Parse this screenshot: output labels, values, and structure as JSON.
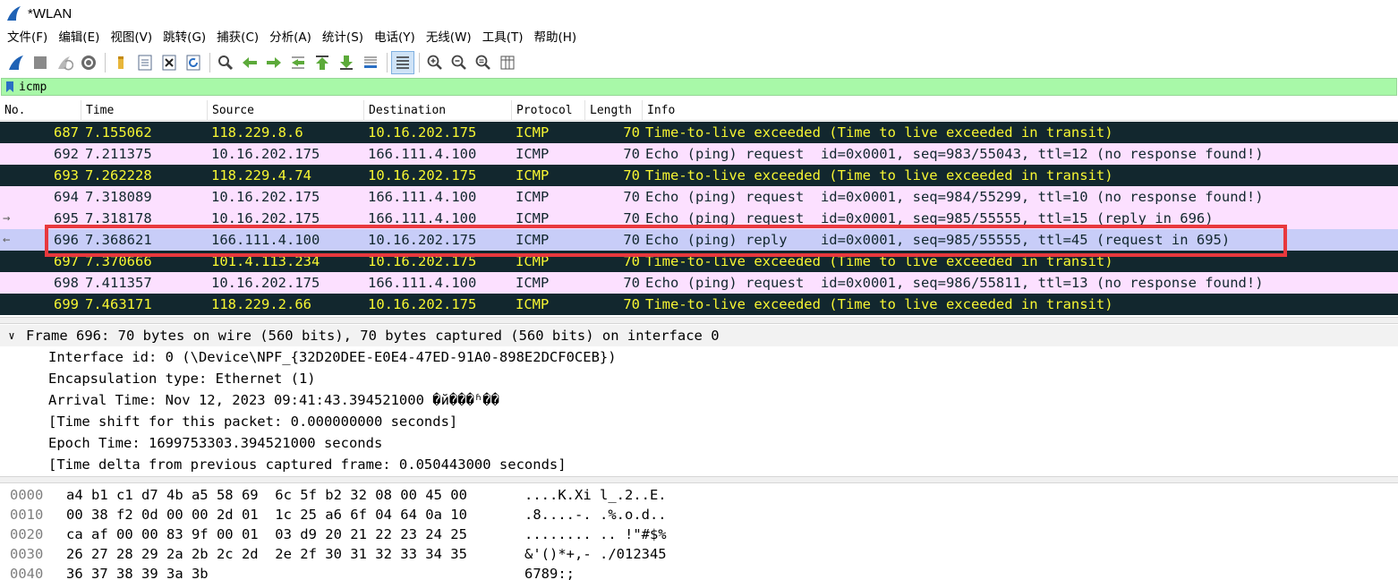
{
  "window": {
    "title": "*WLAN"
  },
  "menu": [
    "文件(F)",
    "编辑(E)",
    "视图(V)",
    "跳转(G)",
    "捕获(C)",
    "分析(A)",
    "统计(S)",
    "电话(Y)",
    "无线(W)",
    "工具(T)",
    "帮助(H)"
  ],
  "toolbar": {
    "icons": [
      "start-capture-icon",
      "stop-capture-icon",
      "restart-capture-icon",
      "capture-options-icon",
      "open-file-icon",
      "save-file-icon",
      "close-file-icon",
      "reload-file-icon",
      "find-packet-icon",
      "go-back-icon",
      "go-forward-icon",
      "go-to-packet-icon",
      "go-first-icon",
      "go-last-icon",
      "autoscroll-icon",
      "colorize-icon",
      "zoom-in-icon",
      "zoom-out-icon",
      "zoom-normal-icon",
      "resize-columns-icon"
    ]
  },
  "filter": {
    "value": "icmp"
  },
  "columns": [
    "No.",
    "Time",
    "Source",
    "Destination",
    "Protocol",
    "Length",
    "Info"
  ],
  "packets": [
    {
      "no": "687",
      "time": "7.155062",
      "src": "118.229.8.6",
      "dst": "10.16.202.175",
      "proto": "ICMP",
      "len": "70",
      "info": "Time-to-live exceeded (Time to live exceeded in transit)",
      "style": "ttl",
      "arrow": ""
    },
    {
      "no": "692",
      "time": "7.211375",
      "src": "10.16.202.175",
      "dst": "166.111.4.100",
      "proto": "ICMP",
      "len": "70",
      "info": "Echo (ping) request  id=0x0001, seq=983/55043, ttl=12 (no response found!)",
      "style": "echo",
      "arrow": ""
    },
    {
      "no": "693",
      "time": "7.262228",
      "src": "118.229.4.74",
      "dst": "10.16.202.175",
      "proto": "ICMP",
      "len": "70",
      "info": "Time-to-live exceeded (Time to live exceeded in transit)",
      "style": "ttl",
      "arrow": ""
    },
    {
      "no": "694",
      "time": "7.318089",
      "src": "10.16.202.175",
      "dst": "166.111.4.100",
      "proto": "ICMP",
      "len": "70",
      "info": "Echo (ping) request  id=0x0001, seq=984/55299, ttl=10 (no response found!)",
      "style": "echo",
      "arrow": ""
    },
    {
      "no": "695",
      "time": "7.318178",
      "src": "10.16.202.175",
      "dst": "166.111.4.100",
      "proto": "ICMP",
      "len": "70",
      "info": "Echo (ping) request  id=0x0001, seq=985/55555, ttl=15 (reply in 696)",
      "style": "echo",
      "arrow": "→"
    },
    {
      "no": "696",
      "time": "7.368621",
      "src": "166.111.4.100",
      "dst": "10.16.202.175",
      "proto": "ICMP",
      "len": "70",
      "info": "Echo (ping) reply    id=0x0001, seq=985/55555, ttl=45 (request in 695)",
      "style": "sel",
      "arrow": "←"
    },
    {
      "no": "697",
      "time": "7.370666",
      "src": "101.4.113.234",
      "dst": "10.16.202.175",
      "proto": "ICMP",
      "len": "70",
      "info": "Time-to-live exceeded (Time to live exceeded in transit)",
      "style": "ttl",
      "arrow": ""
    },
    {
      "no": "698",
      "time": "7.411357",
      "src": "10.16.202.175",
      "dst": "166.111.4.100",
      "proto": "ICMP",
      "len": "70",
      "info": "Echo (ping) request  id=0x0001, seq=986/55811, ttl=13 (no response found!)",
      "style": "echo",
      "arrow": ""
    },
    {
      "no": "699",
      "time": "7.463171",
      "src": "118.229.2.66",
      "dst": "10.16.202.175",
      "proto": "ICMP",
      "len": "70",
      "info": "Time-to-live exceeded (Time to live exceeded in transit)",
      "style": "ttl",
      "arrow": ""
    }
  ],
  "details": {
    "frame_summary": "Frame 696: 70 bytes on wire (560 bits), 70 bytes captured (560 bits) on interface 0",
    "expander": "∨",
    "lines": [
      "Interface id: 0 (\\Device\\NPF_{32D20DEE-E0E4-47ED-91A0-898E2DCF0CEB})",
      "Encapsulation type: Ethernet (1)",
      "Arrival Time: Nov 12, 2023 09:41:43.394521000 �й���ʱ��",
      "[Time shift for this packet: 0.000000000 seconds]",
      "Epoch Time: 1699753303.394521000 seconds",
      "[Time delta from previous captured frame: 0.050443000 seconds]"
    ]
  },
  "bytes": [
    {
      "offset": "0000",
      "hex": "a4 b1 c1 d7 4b a5 58 69  6c 5f b2 32 08 00 45 00",
      "ascii": "....K.Xi l_.2..E."
    },
    {
      "offset": "0010",
      "hex": "00 38 f2 0d 00 00 2d 01  1c 25 a6 6f 04 64 0a 10",
      "ascii": ".8....-. .%.o.d.."
    },
    {
      "offset": "0020",
      "hex": "ca af 00 00 83 9f 00 01  03 d9 20 21 22 23 24 25",
      "ascii": "........ .. !\"#$%"
    },
    {
      "offset": "0030",
      "hex": "26 27 28 29 2a 2b 2c 2d  2e 2f 30 31 32 33 34 35",
      "ascii": "&'()*+,- ./012345"
    },
    {
      "offset": "0040",
      "hex": "36 37 38 39 3a 3b",
      "ascii": "6789:;"
    }
  ],
  "colors": {
    "ttl_bg": "#12272e",
    "ttl_fg": "#f7f632",
    "echo_bg": "#fce0ff",
    "selected_bg": "#c8cdf8",
    "filter_bg": "#a8f8a8",
    "highlight": "#e8383d"
  }
}
